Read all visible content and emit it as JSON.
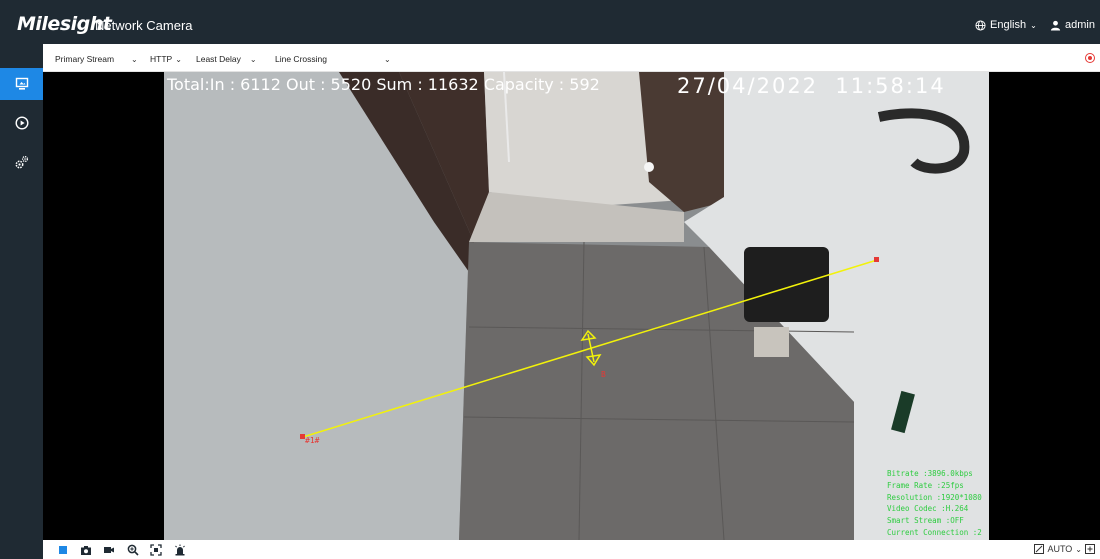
{
  "header": {
    "brand": "Milesight",
    "product": "Network Camera",
    "language": "English",
    "user": "admin"
  },
  "toolbar": {
    "stream": "Primary Stream",
    "protocol": "HTTP",
    "delay": "Least Delay",
    "mode": "Line Crossing"
  },
  "osd": {
    "counter": "Total:In : 6112 Out : 5520 Sum : 11632 Capacity : 592",
    "datetime": "27/04/2022  11:58:14",
    "line_label": "#1#",
    "direction_label": "B",
    "status_lines": [
      "Bitrate :3896.0kbps",
      "Frame Rate :25fps",
      "Resolution :1920*1080",
      "Video Codec :H.264",
      "Smart Stream :OFF",
      "Current Connection :2"
    ]
  },
  "bottombar": {
    "view_mode": "AUTO"
  },
  "colors": {
    "header_bg": "#1f2a33",
    "accent": "#1e88e5",
    "record_red": "#e53935",
    "line_yellow": "#f2f20a",
    "osd_green": "#2ecc40"
  }
}
